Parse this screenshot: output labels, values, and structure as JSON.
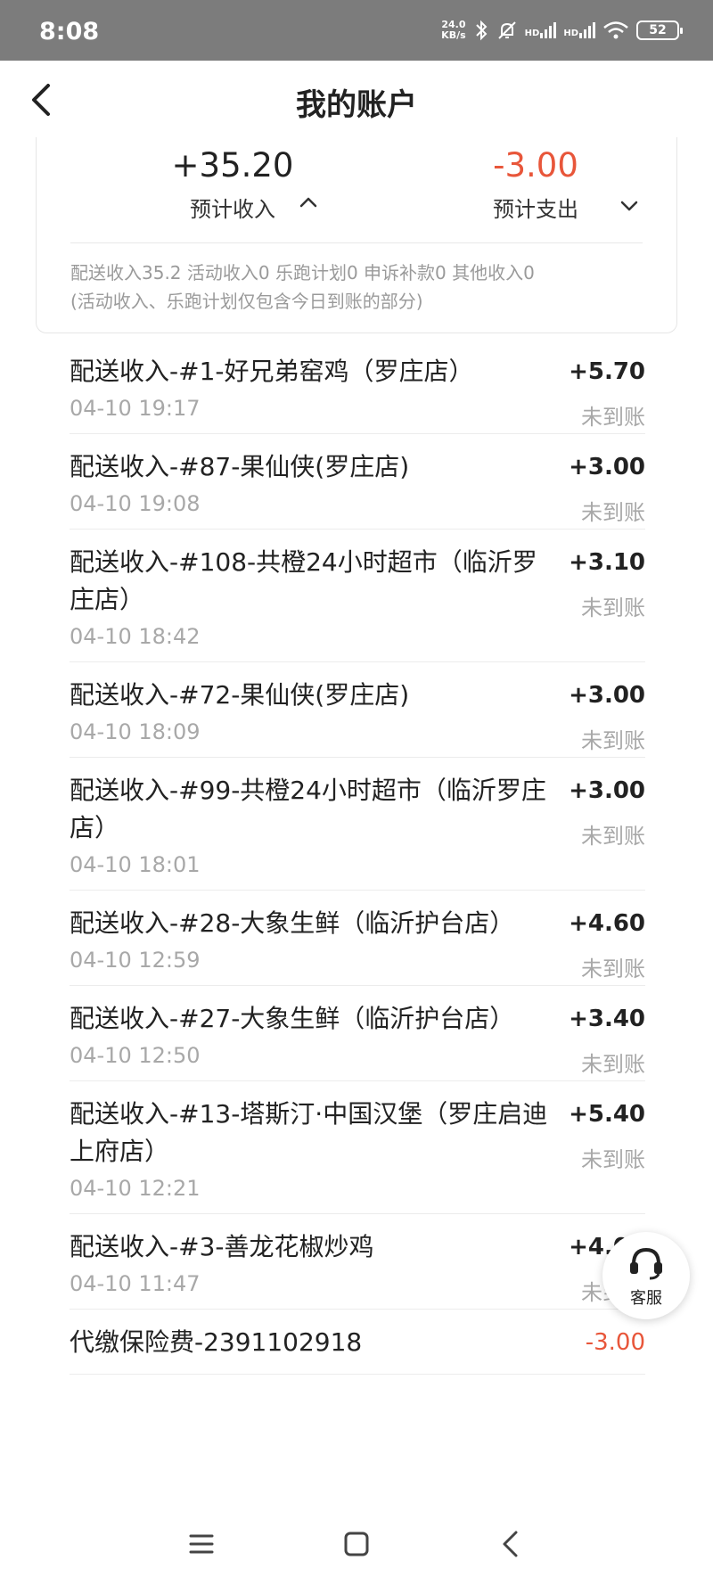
{
  "status_bar": {
    "time": "8:08",
    "net_speed_value": "24.0",
    "net_speed_unit": "KB/s",
    "signal1_label": "HD",
    "signal2_label": "HD",
    "battery": "52"
  },
  "nav": {
    "title": "我的账户"
  },
  "summary": {
    "income_value": "+35.20",
    "income_label": "预计收入",
    "expense_value": "-3.00",
    "expense_label": "预计支出",
    "breakdown_line1": "配送收入35.2 活动收入0 乐跑计划0 申诉补款0 其他收入0",
    "breakdown_line2": "(活动收入、乐跑计划仅包含今日到账的部分)"
  },
  "transactions": [
    {
      "title": "配送收入-#1-好兄弟窑鸡（罗庄店）",
      "time": "04-10 19:17",
      "amount": "+5.70",
      "status": "未到账"
    },
    {
      "title": "配送收入-#87-果仙侠(罗庄店)",
      "time": "04-10 19:08",
      "amount": "+3.00",
      "status": "未到账"
    },
    {
      "title": "配送收入-#108-共橙24小时超市（临沂罗庄店）",
      "time": "04-10 18:42",
      "amount": "+3.10",
      "status": "未到账"
    },
    {
      "title": "配送收入-#72-果仙侠(罗庄店)",
      "time": "04-10 18:09",
      "amount": "+3.00",
      "status": "未到账"
    },
    {
      "title": "配送收入-#99-共橙24小时超市（临沂罗庄店）",
      "time": "04-10 18:01",
      "amount": "+3.00",
      "status": "未到账"
    },
    {
      "title": "配送收入-#28-大象生鲜（临沂护台店）",
      "time": "04-10 12:59",
      "amount": "+4.60",
      "status": "未到账"
    },
    {
      "title": "配送收入-#27-大象生鲜（临沂护台店）",
      "time": "04-10 12:50",
      "amount": "+3.40",
      "status": "未到账"
    },
    {
      "title": "配送收入-#13-塔斯汀·中国汉堡（罗庄启迪上府店）",
      "time": "04-10 12:21",
      "amount": "+5.40",
      "status": "未到账"
    },
    {
      "title": "配送收入-#3-善龙花椒炒鸡",
      "time": "04-10 11:47",
      "amount": "+4.00",
      "status": "未到账"
    },
    {
      "title": "代缴保险费-2391102918",
      "time": "",
      "amount": "-3.00",
      "status": ""
    }
  ],
  "customer_service": {
    "label": "客服"
  },
  "colors": {
    "status_bar_bg": "#7c7c7c",
    "negative_amount": "#e8563a",
    "muted_text": "#a8a8a8"
  }
}
